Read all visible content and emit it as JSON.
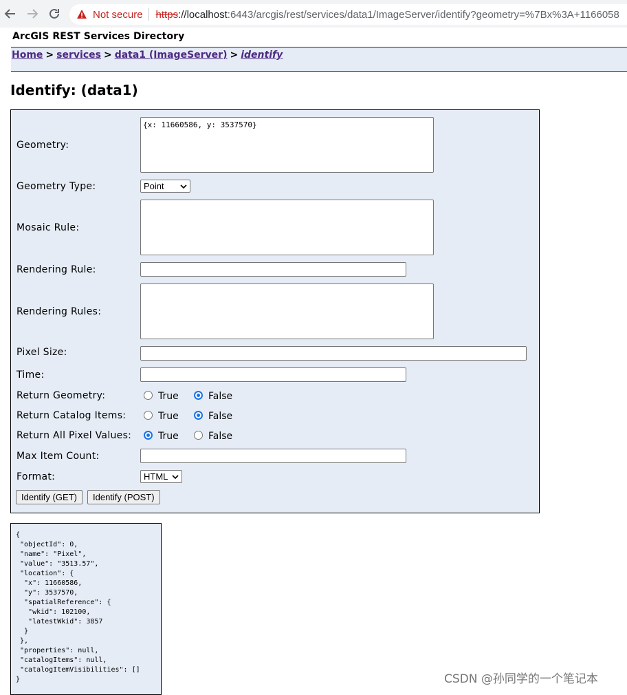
{
  "browser": {
    "security_label": "Not secure",
    "url_scheme": "https",
    "url_host": "://localhost",
    "url_rest": ":6443/arcgis/rest/services/data1/ImageServer/identify?geometry=%7Bx%3A+1166058"
  },
  "page": {
    "directory_title": "ArcGIS REST Services Directory",
    "breadcrumb": {
      "home": "Home",
      "sep": ">",
      "services": "services",
      "server": "data1 (ImageServer)",
      "current": "identify"
    },
    "title": "Identify: (data1)"
  },
  "form": {
    "geometry": {
      "label": "Geometry:",
      "value": "{x: 11660586, y: 3537570}"
    },
    "geometry_type": {
      "label": "Geometry Type:",
      "selected": "Point"
    },
    "mosaic_rule": {
      "label": "Mosaic Rule:",
      "value": ""
    },
    "rendering_rule": {
      "label": "Rendering Rule:",
      "value": ""
    },
    "rendering_rules": {
      "label": "Rendering Rules:",
      "value": ""
    },
    "pixel_size": {
      "label": "Pixel Size:",
      "value": ""
    },
    "time": {
      "label": "Time:",
      "value": ""
    },
    "return_geometry": {
      "label": "Return Geometry:",
      "true_label": "True",
      "false_label": "False",
      "selected": "False"
    },
    "return_catalog_items": {
      "label": "Return Catalog Items:",
      "true_label": "True",
      "false_label": "False",
      "selected": "False"
    },
    "return_all_pixel_values": {
      "label": "Return All Pixel Values:",
      "true_label": "True",
      "false_label": "False",
      "selected": "True"
    },
    "max_item_count": {
      "label": "Max Item Count:",
      "value": ""
    },
    "format": {
      "label": "Format:",
      "selected": "HTML"
    },
    "buttons": {
      "get": "Identify (GET)",
      "post": "Identify (POST)"
    }
  },
  "result": {
    "json_text": "{\n \"objectId\": 0,\n \"name\": \"Pixel\",\n \"value\": \"3513.57\",\n \"location\": {\n  \"x\": 11660586,\n  \"y\": 3537570,\n  \"spatialReference\": {\n   \"wkid\": 102100,\n   \"latestWkid\": 3857\n  }\n },\n \"properties\": null,\n \"catalogItems\": null,\n \"catalogItemVisibilities\": []\n}"
  },
  "watermark": "CSDN @孙同学的一个笔记本",
  "icons": {
    "back": "back-arrow-icon",
    "forward": "forward-arrow-icon",
    "reload": "reload-icon",
    "warning": "warning-triangle-icon",
    "dropdown": "chevron-down-icon"
  }
}
